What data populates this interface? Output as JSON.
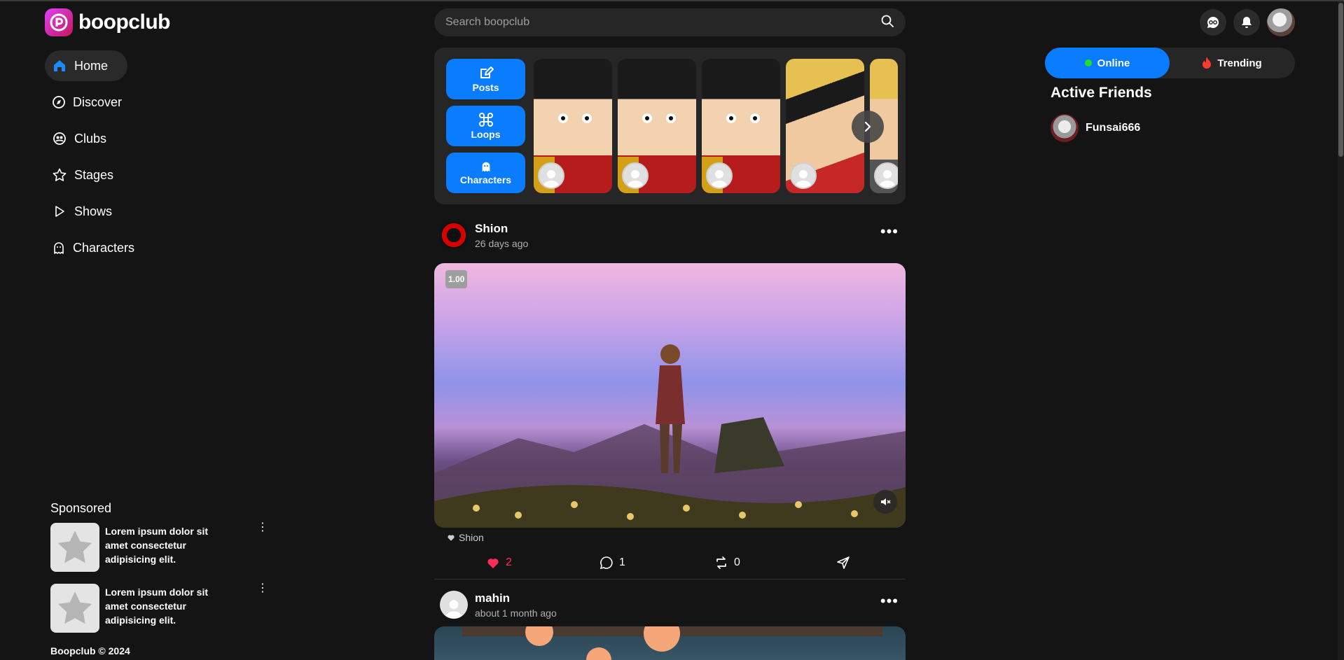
{
  "app": {
    "name": "boopclub"
  },
  "nav": {
    "items": [
      {
        "label": "Home",
        "icon": "home-icon",
        "active": true
      },
      {
        "label": "Discover",
        "icon": "compass-icon"
      },
      {
        "label": "Clubs",
        "icon": "clubs-icon"
      },
      {
        "label": "Stages",
        "icon": "star-icon"
      },
      {
        "label": "Shows",
        "icon": "play-icon"
      },
      {
        "label": "Characters",
        "icon": "ghost-icon"
      }
    ]
  },
  "search": {
    "placeholder": "Search boopclub"
  },
  "stories": {
    "buttons": [
      {
        "label": "Posts",
        "icon": "edit-icon"
      },
      {
        "label": "Loops",
        "icon": "command-icon"
      },
      {
        "label": "Characters",
        "icon": "ghost-icon"
      }
    ]
  },
  "posts": [
    {
      "author": "Shion",
      "time": "26 days ago",
      "speed": "1.00",
      "audio": "Shion",
      "likes": "2",
      "comments": "1",
      "reposts": "0"
    },
    {
      "author": "mahin",
      "time": "about 1 month ago"
    }
  ],
  "right": {
    "tabs": {
      "online": "Online",
      "trending": "Trending"
    },
    "friends_title": "Active Friends",
    "friends": [
      {
        "name": "Funsai666"
      }
    ]
  },
  "sponsored": {
    "title": "Sponsored",
    "ads": [
      {
        "text": "Lorem ipsum dolor sit amet consectetur adipisicing elit."
      },
      {
        "text": "Lorem ipsum dolor sit amet consectetur adipisicing elit."
      }
    ]
  },
  "footer": "Boopclub © 2024",
  "colors": {
    "accent": "#0a7cff",
    "background": "#141414",
    "card": "#262626",
    "like": "#ff2d55",
    "online": "#24e024"
  }
}
